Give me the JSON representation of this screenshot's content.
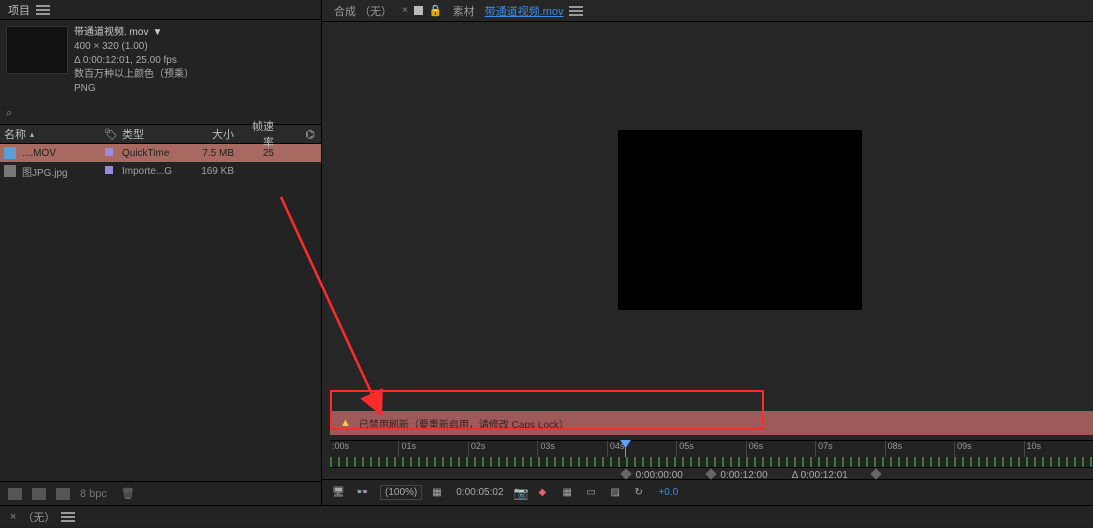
{
  "project": {
    "panel_title": "项目",
    "asset_name": "带通道视频. mov",
    "dimensions": "400 × 320 (1.00)",
    "duration_fps": "Δ 0:00:12:01, 25.00 fps",
    "color_mode": "数百万种以上颜色（预乘）",
    "codec": "PNG"
  },
  "table": {
    "col_name": "名称",
    "col_type": "类型",
    "col_size": "大小",
    "col_fps": "帧速率",
    "rows": [
      {
        "name": "....MOV",
        "type": "QuickTime",
        "size": "7.5 MB",
        "fps": "25"
      },
      {
        "name": "图JPG.jpg",
        "type": "Importe...G",
        "size": "169 KB",
        "fps": ""
      }
    ]
  },
  "bottom_bar": {
    "bpc": "8 bpc"
  },
  "viewer_tabs": {
    "comp_label": "合成",
    "comp_none": "（无）",
    "footage_label": "素材",
    "footage_link": "带通道视频.mov"
  },
  "warning": {
    "text": "已禁用刷新（要重新启用，请修改 Caps Lock）"
  },
  "ruler": {
    "ticks": [
      ":00s",
      "01s",
      "02s",
      "03s",
      "04s",
      "05s",
      "06s",
      "07s",
      "08s",
      "09s",
      "10s"
    ]
  },
  "info_row": {
    "a": "0:00:00:00",
    "b": "0:00:12:00",
    "c": "Δ 0:00:12:01"
  },
  "viewer_footer": {
    "pct": "(100%)",
    "timecode": "0:00:05:02",
    "plus": "+0.0"
  },
  "lower_strip": {
    "none_label": "（无）"
  }
}
